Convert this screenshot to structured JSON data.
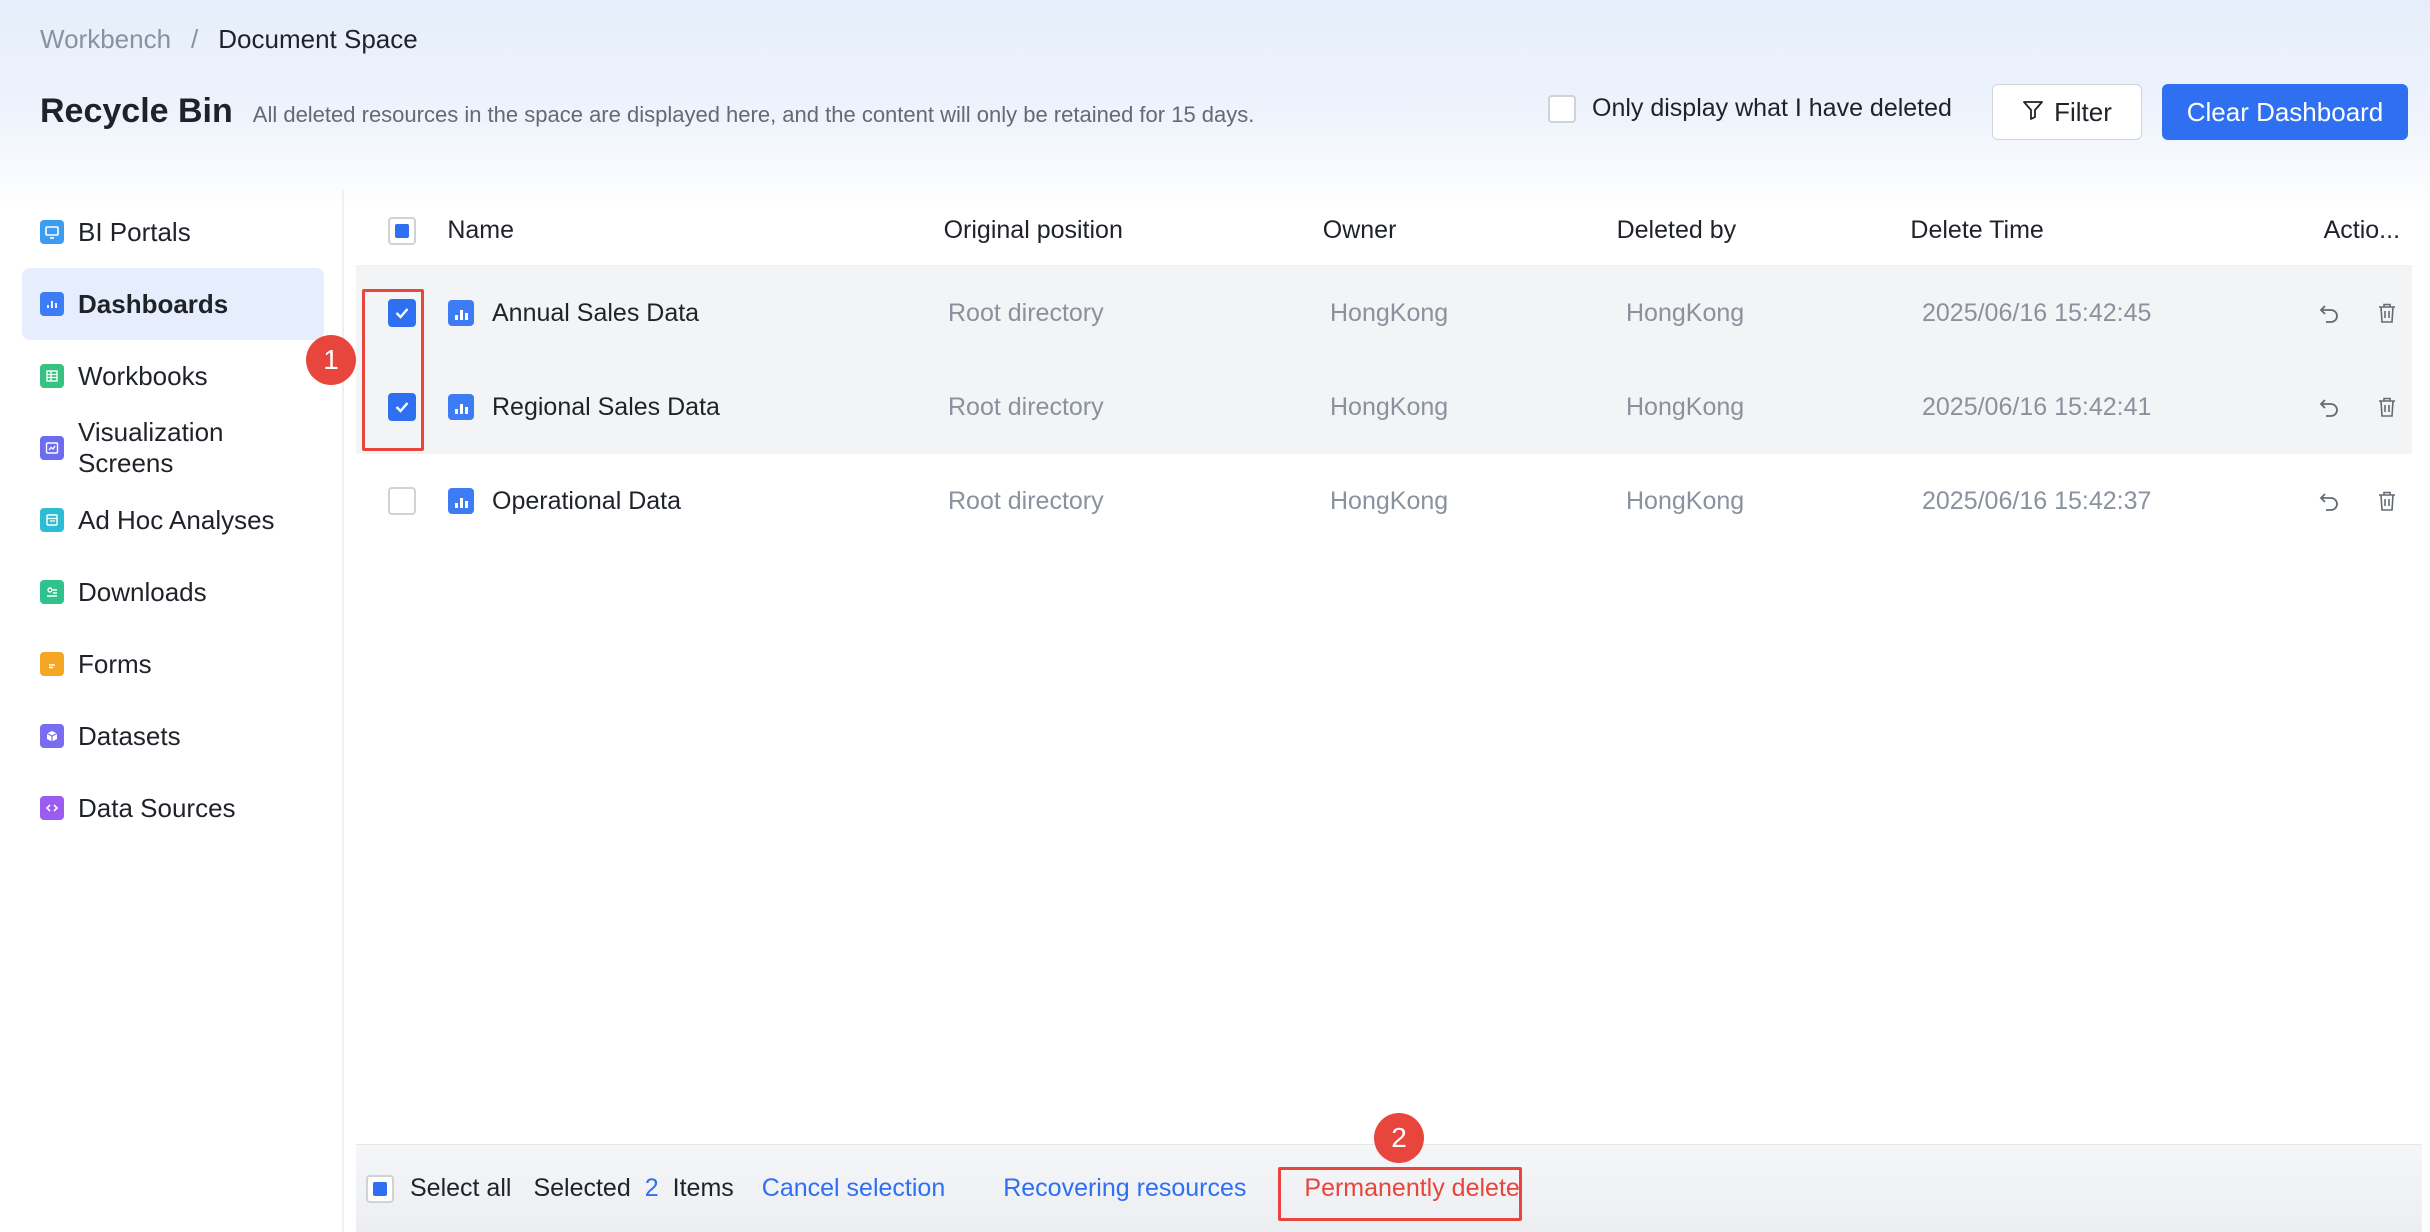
{
  "breadcrumb": {
    "parent": "Workbench",
    "separator": "/",
    "current": "Document Space"
  },
  "header": {
    "title": "Recycle Bin",
    "description": "All deleted resources in the space are displayed here, and the content will only be retained for 15 days.",
    "only_mine_label": "Only display what I have deleted",
    "filter_label": "Filter",
    "clear_label": "Clear Dashboard"
  },
  "sidebar": {
    "items": [
      {
        "label": "BI Portals",
        "icon": "portal-icon",
        "color": "#3b9cf0"
      },
      {
        "label": "Dashboards",
        "icon": "dashboard-icon",
        "color": "#3d7cf5",
        "active": true
      },
      {
        "label": "Workbooks",
        "icon": "workbook-icon",
        "color": "#36c281"
      },
      {
        "label": "Visualization Screens",
        "icon": "screen-icon",
        "color": "#6d6cf0"
      },
      {
        "label": "Ad Hoc Analyses",
        "icon": "adhoc-icon",
        "color": "#2cbcd3"
      },
      {
        "label": "Downloads",
        "icon": "download-icon",
        "color": "#2ec28d"
      },
      {
        "label": "Forms",
        "icon": "form-icon",
        "color": "#f5a623"
      },
      {
        "label": "Datasets",
        "icon": "dataset-icon",
        "color": "#7a6cf0"
      },
      {
        "label": "Data Sources",
        "icon": "datasource-icon",
        "color": "#9b5cf0"
      }
    ]
  },
  "table": {
    "columns": [
      "Name",
      "Original position",
      "Owner",
      "Deleted by",
      "Delete Time",
      "Actio..."
    ],
    "rows": [
      {
        "name": "Annual Sales Data",
        "position": "Root directory",
        "owner": "HongKong",
        "deleted_by": "HongKong",
        "time": "2025/06/16 15:42:45",
        "checked": true
      },
      {
        "name": "Regional Sales Data",
        "position": "Root directory",
        "owner": "HongKong",
        "deleted_by": "HongKong",
        "time": "2025/06/16 15:42:41",
        "checked": true
      },
      {
        "name": "Operational Data",
        "position": "Root directory",
        "owner": "HongKong",
        "deleted_by": "HongKong",
        "time": "2025/06/16 15:42:37",
        "checked": false
      }
    ]
  },
  "footer": {
    "select_all": "Select all",
    "selected_prefix": "Selected",
    "selected_count": "2",
    "items_suffix": "Items",
    "cancel_selection": "Cancel selection",
    "recover": "Recovering resources",
    "permanent_delete": "Permanently delete"
  },
  "annotations": {
    "step1": "1",
    "step2": "2"
  },
  "colors": {
    "accent": "#2f6ff2",
    "danger": "#e8453c"
  }
}
